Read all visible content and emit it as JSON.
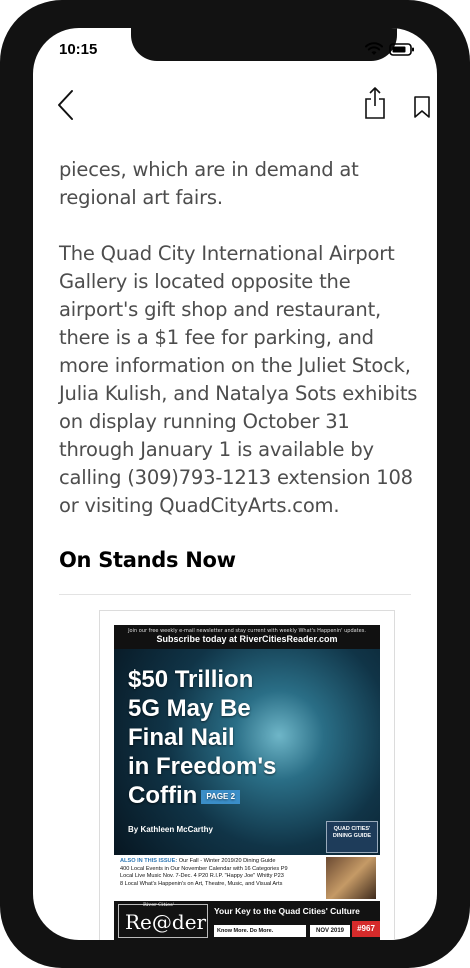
{
  "status_bar": {
    "time": "10:15"
  },
  "article": {
    "paragraphs": [
      "pieces, which are in demand at regional art fairs.",
      "The Quad City International Airport Gallery is located opposite the airport's gift shop and restaurant, there is a $1 fee for parking, and more information on the Juliet Stock, Julia Kulish, and Natalya Sots exhibits on display running October 31 through January 1 is available by calling (309)793-1213 extension 108 or visiting QuadCityArts.com."
    ]
  },
  "section": {
    "title": "On Stands Now"
  },
  "cover": {
    "top_small": "Join our free weekly e-mail newsletter and stay current with weekly What's Happenin' updates.",
    "top_subscribe": "Subscribe today at RiverCitiesReader.com",
    "headline_lines": [
      "$50 Trillion",
      "5G May Be",
      "Final Nail",
      "in Freedom's",
      "Coffin"
    ],
    "page_tag": "PAGE 2",
    "byline": "By Kathleen McCarthy",
    "guide_title": "QUAD CITIES' DINING GUIDE",
    "also_label": "ALSO IN THIS ISSUE:",
    "also_lines": [
      "Our Fall - Winter 2019/20 Dining Guide",
      "400 Local Events in Our November Calendar with 16 Categories P9",
      "Local Live Music Nov. 7-Dec. 4 P20   R.I.P. \"Happy Joe\" Whitty P23",
      "8 Local What's Happenin's on Art, Theatre, Music, and Visual Arts"
    ],
    "logo_small": "River Cities'",
    "logo_text": "Re@der",
    "banner_key": "Your Key to the Quad Cities' Culture",
    "banner_know": "Know More. Do More.",
    "issue_date": "NOV 2019",
    "issue_number": "#967"
  },
  "colors": {
    "frame": "#121212",
    "body_text": "#4d4d4d",
    "heading": "#000000",
    "accent_blue": "#3b8ec8",
    "issue_red": "#d52b2b"
  }
}
